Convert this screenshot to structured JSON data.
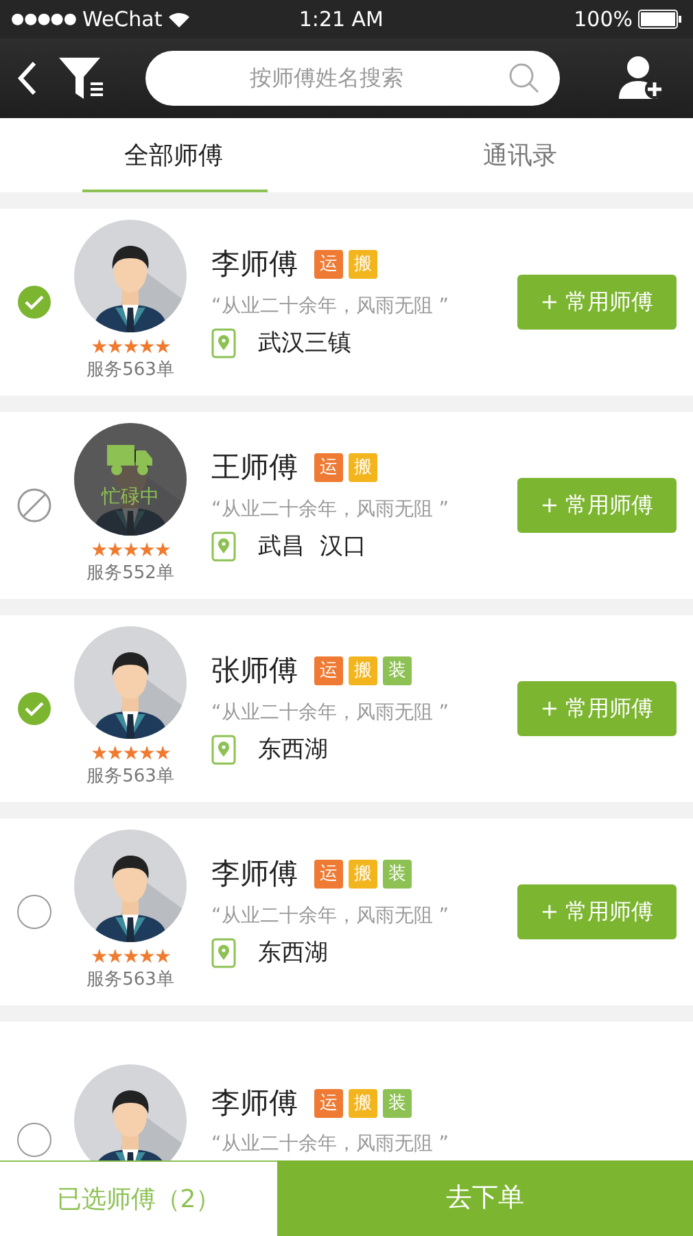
{
  "status_bar": {
    "signal": "●●●●●",
    "carrier": "WeChat",
    "time": "1:21 AM",
    "battery": "100%"
  },
  "search": {
    "placeholder": "按师傅姓名搜索"
  },
  "tabs": [
    {
      "label": "全部师傅",
      "selected": true
    },
    {
      "label": "通讯录",
      "selected": false
    }
  ],
  "masters": [
    {
      "name": "李师傅",
      "selected": true,
      "busy": false,
      "stars": 5,
      "orders": "服务563单",
      "tags": [
        {
          "label": "运",
          "color": "#ee7a33"
        },
        {
          "label": "搬",
          "color": "#f3b51d"
        }
      ],
      "motto": "“从业二十余年，风雨无阻 ”",
      "location": "武汉三镇",
      "button": "+ 常用师傅"
    },
    {
      "name": "王师傅",
      "selected": false,
      "busy": true,
      "busy_label": "忙碌中",
      "stars": 5,
      "orders": "服务552单",
      "tags": [
        {
          "label": "运",
          "color": "#ee7a33"
        },
        {
          "label": "搬",
          "color": "#f3b51d"
        }
      ],
      "motto": "“从业二十余年，风雨无阻 ”",
      "location": "武昌  汉口",
      "button": "+ 常用师傅"
    },
    {
      "name": "张师傅",
      "selected": true,
      "busy": false,
      "stars": 5,
      "orders": "服务563单",
      "tags": [
        {
          "label": "运",
          "color": "#ee7a33"
        },
        {
          "label": "搬",
          "color": "#f3b51d"
        },
        {
          "label": "装",
          "color": "#8dc153"
        }
      ],
      "motto": "“从业二十余年，风雨无阻 ”",
      "location": "东西湖",
      "button": "+ 常用师傅"
    },
    {
      "name": "李师傅",
      "selected": false,
      "busy": false,
      "stars": 5,
      "orders": "服务563单",
      "tags": [
        {
          "label": "运",
          "color": "#ee7a33"
        },
        {
          "label": "搬",
          "color": "#f3b51d"
        },
        {
          "label": "装",
          "color": "#8dc153"
        }
      ],
      "motto": "“从业二十余年，风雨无阻 ”",
      "location": "东西湖",
      "button": "+ 常用师傅"
    },
    {
      "name": "李师傅",
      "selected": false,
      "busy": false,
      "tags": [
        {
          "label": "运",
          "color": "#ee7a33"
        },
        {
          "label": "搬",
          "color": "#f3b51d"
        },
        {
          "label": "装",
          "color": "#8dc153"
        }
      ],
      "motto": "“从业二十余年，风雨无阻 ”"
    }
  ],
  "footer": {
    "selected_count": "已选师傅（2）",
    "order_button": "去下单"
  }
}
